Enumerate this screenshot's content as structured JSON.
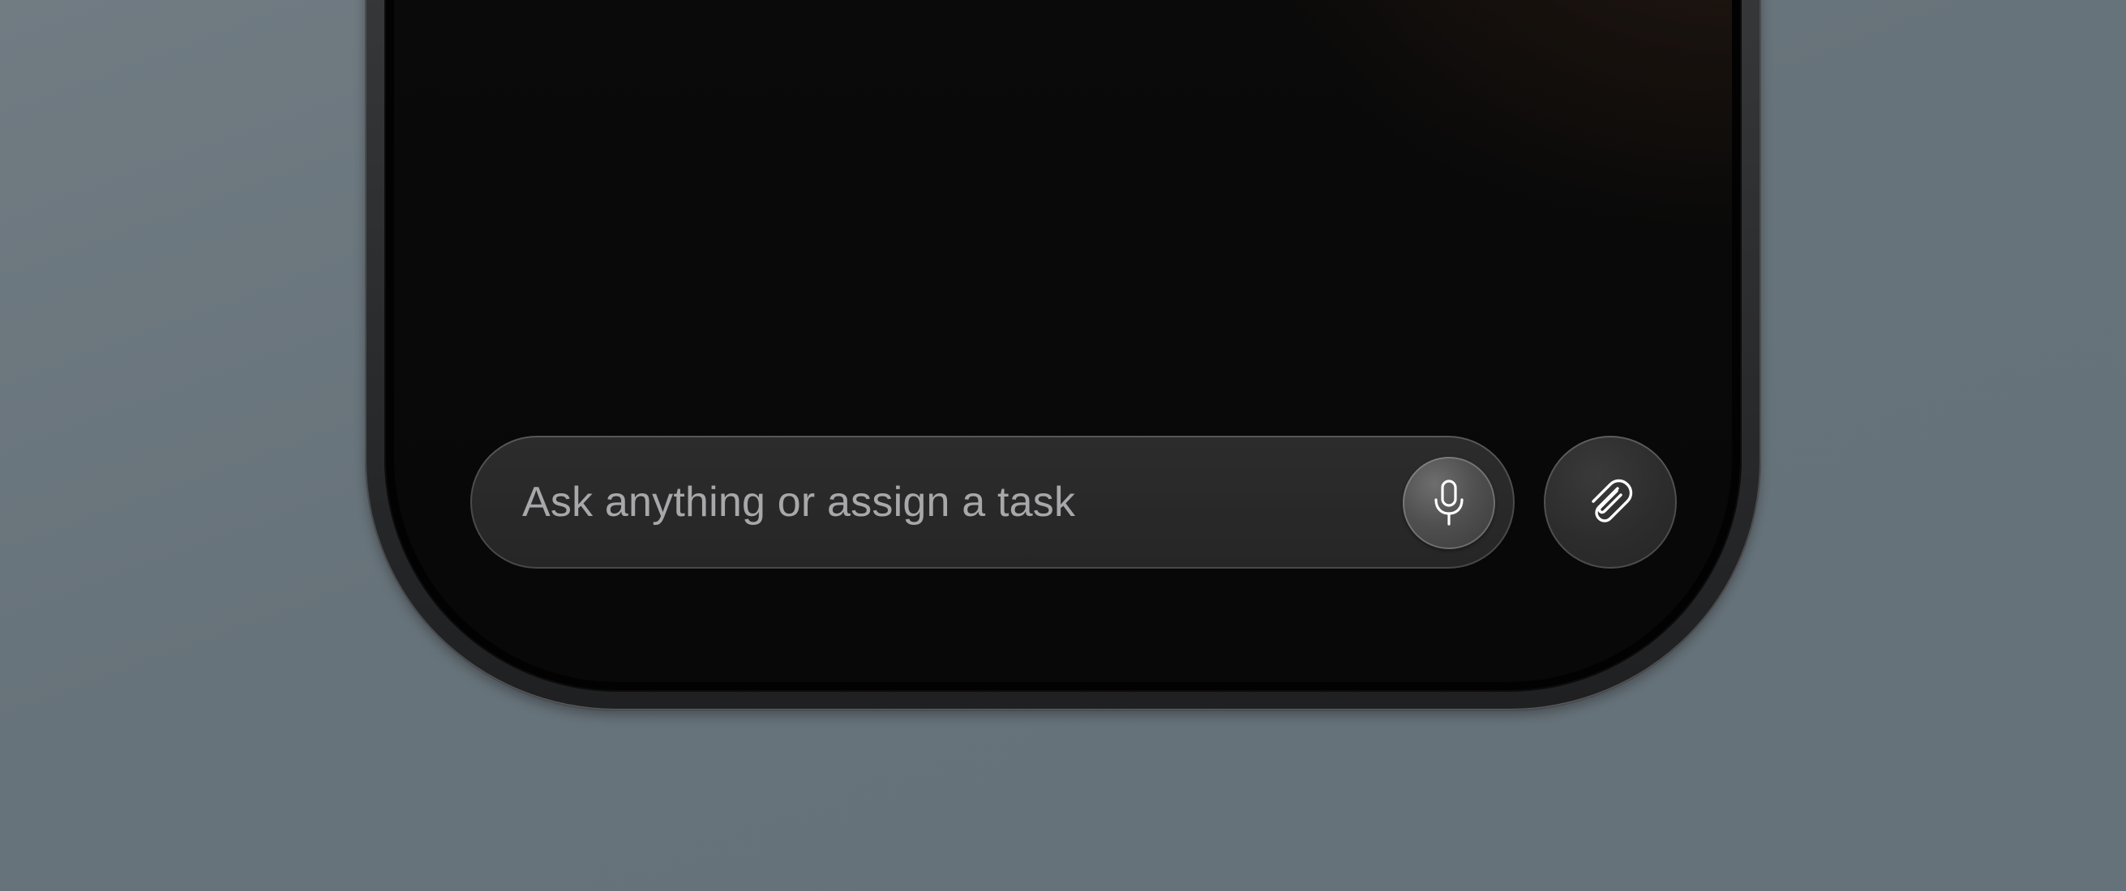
{
  "composer": {
    "placeholder": "Ask anything or assign a task",
    "mic_button_icon": "microphone-icon",
    "attach_button_icon": "paperclip-icon"
  },
  "colors": {
    "background": "#6b767d",
    "screen": "#080808",
    "screen_glow": "#2e1f15",
    "pill_fill": "#2a2a2a",
    "placeholder_text": "#a8a8aa"
  }
}
